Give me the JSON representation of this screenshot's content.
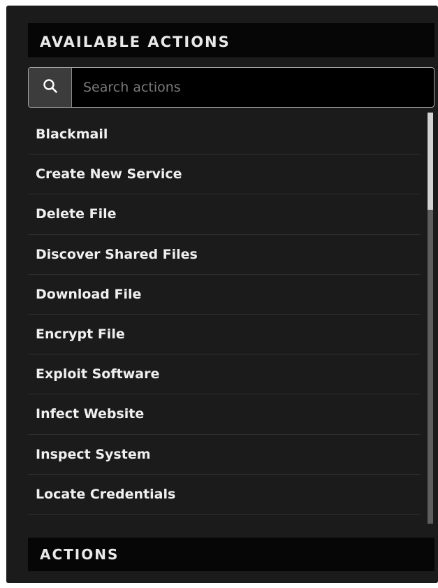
{
  "available_actions": {
    "title": "AVAILABLE ACTIONS",
    "search": {
      "placeholder": "Search actions",
      "value": "",
      "icon": "search-icon"
    },
    "items": [
      "Blackmail",
      "Create New Service",
      "Delete File",
      "Discover Shared Files",
      "Download File",
      "Encrypt File",
      "Exploit Software",
      "Infect Website",
      "Inspect System",
      "Locate Credentials"
    ],
    "scroll_fraction_visible": 0.24
  },
  "actions": {
    "title": "ACTIONS"
  },
  "colors": {
    "panel_background": "#1b1b1b",
    "header_background": "#060606",
    "text": "#f0f0f0",
    "placeholder": "#7a7a7a"
  }
}
